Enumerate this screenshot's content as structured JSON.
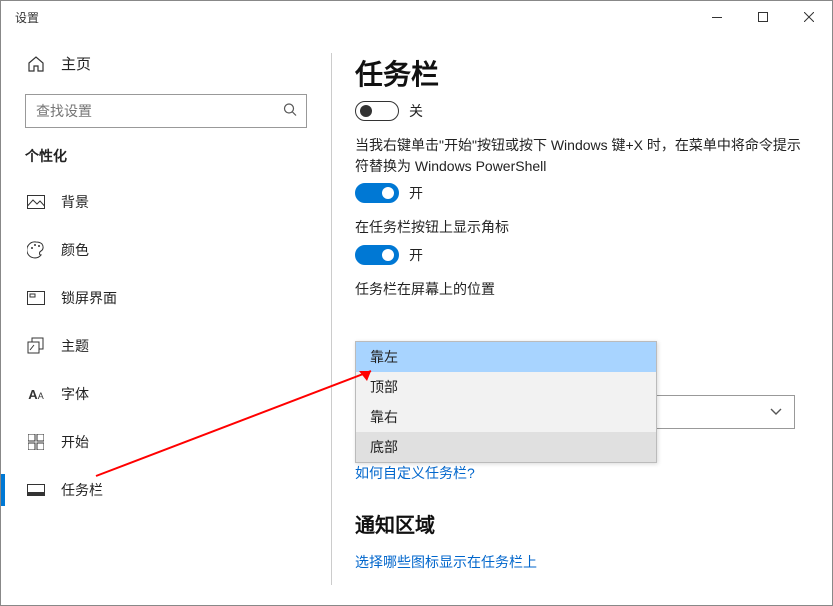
{
  "window": {
    "title": "设置"
  },
  "sidebar": {
    "home": "主页",
    "search_placeholder": "查找设置",
    "section": "个性化",
    "items": [
      {
        "label": "背景"
      },
      {
        "label": "颜色"
      },
      {
        "label": "锁屏界面"
      },
      {
        "label": "主题"
      },
      {
        "label": "字体"
      },
      {
        "label": "开始"
      },
      {
        "label": "任务栏"
      }
    ]
  },
  "content": {
    "title": "任务栏",
    "toggle1": {
      "state": "off",
      "label": "关"
    },
    "desc1": "当我右键单击\"开始\"按钮或按下 Windows 键+X 时，在菜单中将命令提示符替换为 Windows PowerShell",
    "toggle2": {
      "state": "on",
      "label": "开"
    },
    "desc2": "在任务栏按钮上显示角标",
    "toggle3": {
      "state": "on",
      "label": "开"
    },
    "position": {
      "title": "任务栏在屏幕上的位置",
      "options": [
        "靠左",
        "顶部",
        "靠右",
        "底部"
      ]
    },
    "link1": "如何自定义任务栏?",
    "section2": "通知区域",
    "link2": "选择哪些图标显示在任务栏上"
  }
}
